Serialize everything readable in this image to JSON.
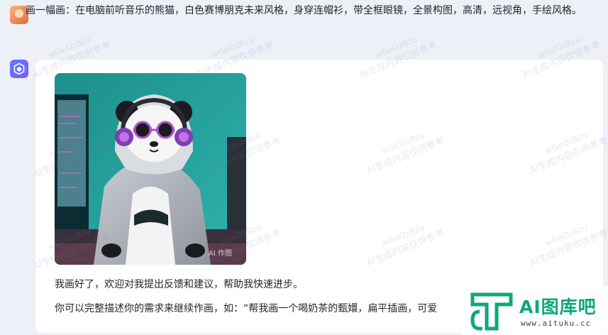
{
  "user_message": {
    "text": "画一幅画：在电脑前听音乐的熊猫，白色赛博朋克未来风格，身穿连帽衫，带全框眼镜，全景构图，高清，远视角，手绘风格。"
  },
  "assistant_message": {
    "image_badge": "AI 作图",
    "reply_line_1": "我画好了，欢迎对我提出反馈和建议，帮助我快速进步。",
    "reply_line_2": "你可以完整描述你的需求来继续作画，如：“帮我画一个喝奶茶的甄嬛，扁平插画，可爱"
  },
  "watermark": {
    "id_text": "wGeOz8zu",
    "notice_text": "AI生成内容仅供参考"
  },
  "brand": {
    "name": "AI图库吧",
    "url": "www.aituku.cc",
    "color": "#0fa77b"
  }
}
